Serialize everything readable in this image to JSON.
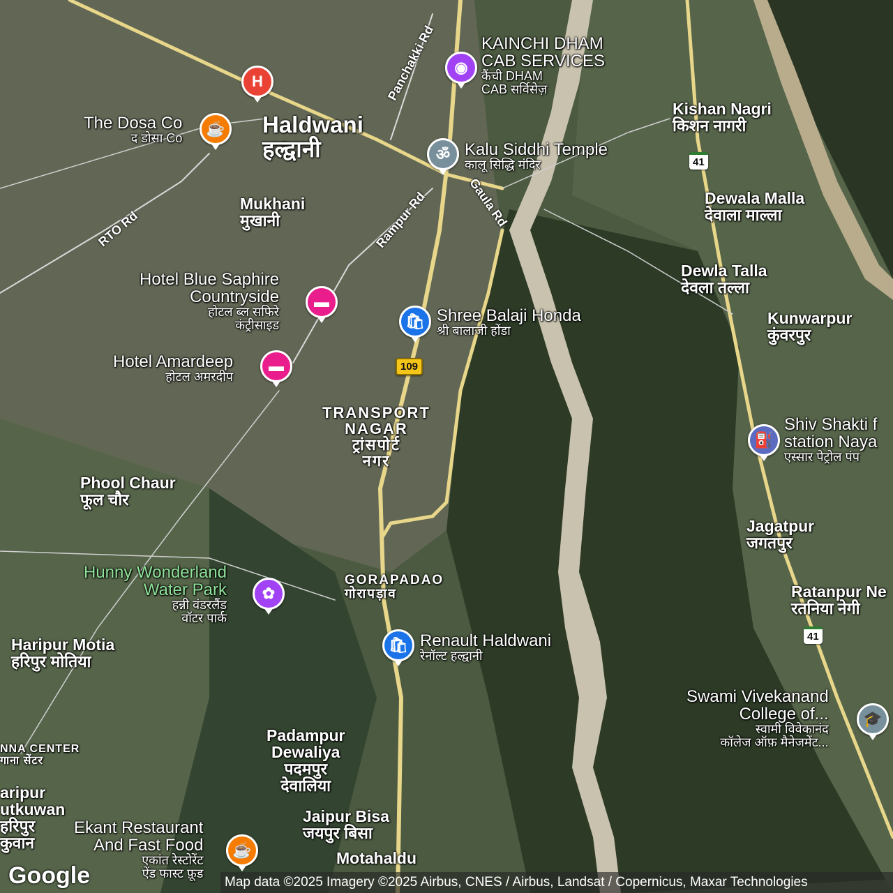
{
  "map": {
    "places": {
      "haldwani": {
        "name": "Haldwani",
        "local": "हल्द्वानी"
      },
      "mukhani": {
        "name": "Mukhani",
        "local": "मुखानी"
      },
      "transport_nagar": {
        "name": "TRANSPORT",
        "name2": "NAGAR",
        "local": "ट्रांसपोर्ट",
        "local2": "नगर"
      },
      "phool_chaur": {
        "name": "Phool Chaur",
        "local": "फूल चौर"
      },
      "gorapadao": {
        "name": "GORAPADAO",
        "local": "गोरापड़ाव"
      },
      "haripur_motia": {
        "name": "Haripur Motia",
        "local": "हरिपुर मोतिया"
      },
      "padampur": {
        "name": "Padampur",
        "name2": "Dewaliya",
        "local": "पदमपुर",
        "local2": "देवालिया"
      },
      "jaipur_bisa": {
        "name": "Jaipur Bisa",
        "local": "जयपुर बिसा"
      },
      "motahaldu": {
        "name": "Motahaldu"
      },
      "kishan_nagri": {
        "name": "Kishan Nagri",
        "local": "किशन नागरी"
      },
      "dewala_malla": {
        "name": "Dewala Malla",
        "local": "देवाला माल्ला"
      },
      "dewla_talla": {
        "name": "Dewla Talla",
        "local": "देवला तल्ला"
      },
      "kunwarpur": {
        "name": "Kunwarpur",
        "local": "कुंवरपुर"
      },
      "jagatpur": {
        "name": "Jagatpur",
        "local": "जगतपुर"
      },
      "ratanpur": {
        "name": "Ratanpur Ne",
        "local": "रतनिया नेगी"
      },
      "haripur_left": {
        "name": "aripur",
        "name2": "utkuwan",
        "local": "हरिपुर",
        "local2": "कुवान"
      },
      "anna_center": {
        "name": "NNA CENTER",
        "local": "गाना सेंटर"
      }
    },
    "pois": {
      "kainchi": {
        "name": "KAINCHI DHAM",
        "name2": "CAB SERVICES",
        "local": "कैंची DHAM",
        "local2": "CAB सर्विसेज़",
        "icon": "camera-icon",
        "color": "#a142f4"
      },
      "kalu_temple": {
        "name": "Kalu Siddhi Temple",
        "local": "कालू सिद्धि मंदिर",
        "icon": "om-icon",
        "color": "#78909c"
      },
      "dosa": {
        "name": "The Dosa Co",
        "local": "द डोसा Co",
        "icon": "restaurant-icon",
        "color": "#f57c00"
      },
      "hospital": {
        "name": "H",
        "icon": "hospital-icon",
        "color": "#ea4335"
      },
      "blue_saphire": {
        "name": "Hotel Blue Saphire",
        "name2": "Countryside",
        "local": "होटल ब्ल सफिरे",
        "local2": "कंट्रीसाइड",
        "icon": "bed-icon",
        "color": "#e91e8c"
      },
      "amardeep": {
        "name": "Hotel Amardeep",
        "local": "होटल अमरदीप",
        "icon": "bed-icon",
        "color": "#e91e8c"
      },
      "balaji": {
        "name": "Shree Balaji Honda",
        "local": "श्री बालाजी होंडा",
        "icon": "shopping-bag-icon",
        "color": "#1a73e8"
      },
      "hunny": {
        "name": "Hunny Wonderland",
        "name2": "Water Park",
        "local": "हन्नी वंडरलैंड",
        "local2": "वॉटर पार्क",
        "icon": "amusement-icon",
        "color": "#a142f4",
        "text_color": "#8fe39a"
      },
      "renault": {
        "name": "Renault Haldwani",
        "local": "रेनॉल्ट हल्द्वानी",
        "icon": "shopping-bag-icon",
        "color": "#1a73e8"
      },
      "shiv_shakti": {
        "name": "Shiv Shakti f",
        "name2": "station Naya",
        "local": "एस्सार पेट्रोल पंप",
        "icon": "fuel-icon",
        "color": "#5c6bc0"
      },
      "vivekanand": {
        "name": "Swami Vivekanand",
        "name2": "College of...",
        "local": "स्वामी विवेकानंद",
        "local2": "कॉलेज ऑफ़ मैनेजमेंट...",
        "icon": "graduation-cap-icon",
        "color": "#78909c"
      },
      "ekant": {
        "name": "Ekant Restaurant",
        "name2": "And Fast Food",
        "local": "एकांत रेस्टोरेंट",
        "local2": "ऐंड फास्ट फ़ूड",
        "icon": "restaurant-icon",
        "color": "#f57c00"
      }
    },
    "roads": {
      "panchakki": "Panchakki Rd",
      "rto": "RTO Rd",
      "rampur": "Rampur Rd",
      "gaula": "Gaula Rd"
    },
    "shields": {
      "nh41_a": "41",
      "nh41_b": "41",
      "nh109": "109"
    },
    "attribution": "Map data ©2025 Imagery ©2025 Airbus, CNES / Airbus, Landsat / Copernicus, Maxar Technologies",
    "logo": "Google"
  }
}
